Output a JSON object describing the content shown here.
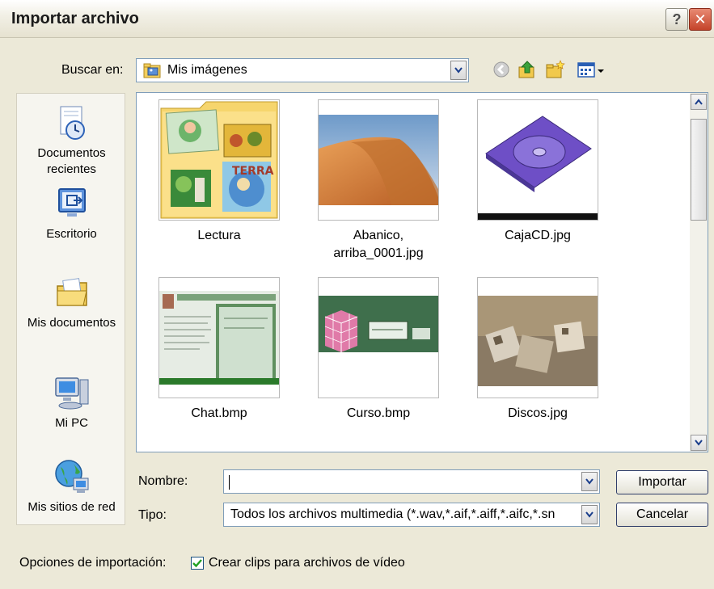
{
  "dialog": {
    "title": "Importar archivo"
  },
  "lookin": {
    "label": "Buscar en:",
    "value": "Mis imágenes"
  },
  "places": [
    {
      "label": "Documentos recientes",
      "icon": "recent-documents-icon"
    },
    {
      "label": "Escritorio",
      "icon": "desktop-icon"
    },
    {
      "label": "Mis documentos",
      "icon": "my-documents-icon"
    },
    {
      "label": "Mi PC",
      "icon": "my-computer-icon"
    },
    {
      "label": "Mis sitios de red",
      "icon": "network-places-icon"
    }
  ],
  "files": [
    {
      "name": "Lectura",
      "type": "folder"
    },
    {
      "name": "Abanico, arriba_0001.jpg",
      "type": "image"
    },
    {
      "name": "CajaCD.jpg",
      "type": "image"
    },
    {
      "name": "Chat.bmp",
      "type": "image"
    },
    {
      "name": "Curso.bmp",
      "type": "image"
    },
    {
      "name": "Discos.jpg",
      "type": "image"
    }
  ],
  "filename": {
    "label": "Nombre:",
    "value": ""
  },
  "filetype": {
    "label": "Tipo:",
    "value": "Todos los archivos multimedia (*.wav,*.aif,*.aiff,*.aifc,*.sn"
  },
  "buttons": {
    "import": "Importar",
    "cancel": "Cancelar"
  },
  "options": {
    "label": "Opciones de importación:",
    "checkbox_label": "Crear clips para archivos de vídeo",
    "checked": true
  },
  "colors": {
    "face": "#ECE9D8",
    "border": "#7f9db9",
    "close": "#c4432a"
  }
}
